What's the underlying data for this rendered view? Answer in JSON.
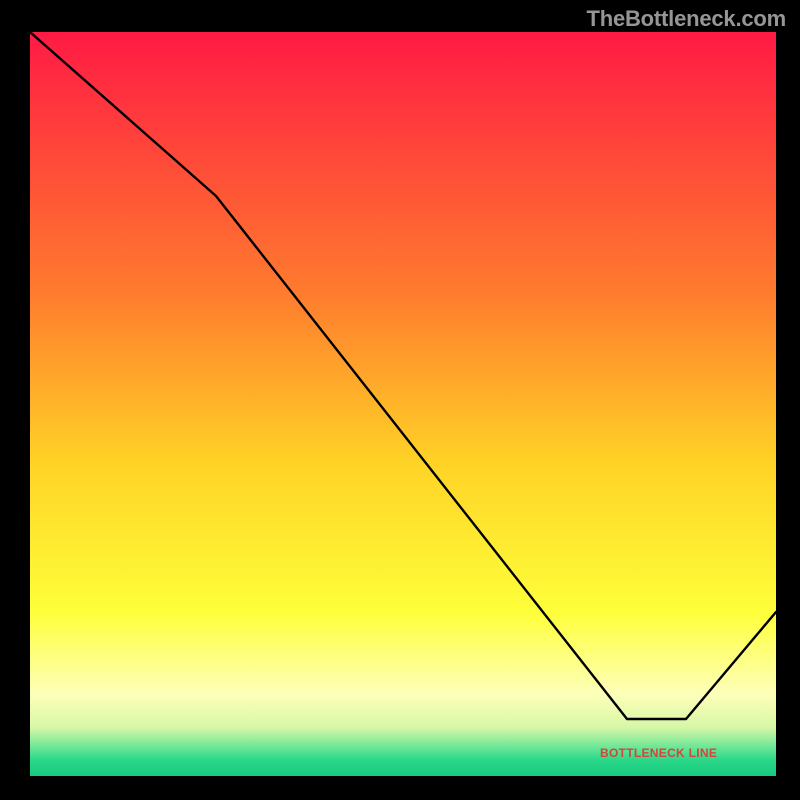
{
  "branding": {
    "watermark": "TheBottleneck.com"
  },
  "label": {
    "bottom_marker": "BOTTLENECK LINE"
  },
  "chart_data": {
    "type": "line",
    "title": "",
    "xlabel": "",
    "ylabel": "",
    "xlim": [
      0,
      100
    ],
    "ylim": [
      0,
      100
    ],
    "background_gradient_stops": [
      {
        "offset": 0.0,
        "color": "#ff1a44"
      },
      {
        "offset": 0.35,
        "color": "#ff7b2e"
      },
      {
        "offset": 0.58,
        "color": "#ffd326"
      },
      {
        "offset": 0.78,
        "color": "#feff3a"
      },
      {
        "offset": 0.89,
        "color": "#fdffb9"
      },
      {
        "offset": 0.935,
        "color": "#d7f7a6"
      },
      {
        "offset": 0.962,
        "color": "#69e696"
      },
      {
        "offset": 0.978,
        "color": "#2bd889"
      },
      {
        "offset": 1.0,
        "color": "#18c97e"
      }
    ],
    "series": [
      {
        "name": "bottleneck-curve",
        "x": [
          0,
          25,
          80,
          88,
          100
        ],
        "y": [
          100,
          78,
          7.6,
          7.6,
          22
        ]
      }
    ],
    "marker": {
      "x": 82,
      "y": 7.8,
      "text": "BOTTLENECK LINE"
    }
  }
}
